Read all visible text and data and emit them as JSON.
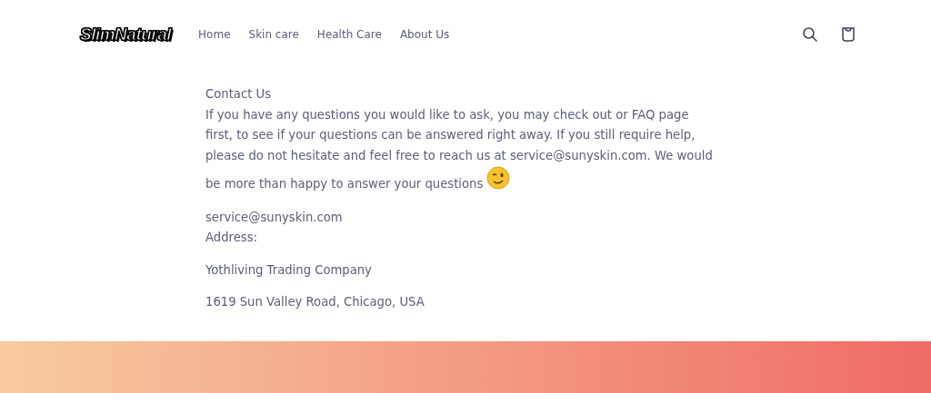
{
  "header": {
    "logo": "SlimNatural",
    "nav": [
      {
        "label": "Home"
      },
      {
        "label": "Skin care"
      },
      {
        "label": "Health Care"
      },
      {
        "label": "About Us"
      }
    ]
  },
  "contact": {
    "title": "Contact Us",
    "paragraph": "If you have any questions you would like to ask, you may check out or FAQ page first, to see if your questions can be answered right away. If you still require help, please do not hesitate and feel free to reach us at service@sunyskin.com. We would be more than happy to answer your questions",
    "email": "service@sunyskin.com",
    "address_label": "Address:",
    "company": "Yothliving Trading Company",
    "street": "1619 Sun Valley Road, Chicago, USA"
  }
}
